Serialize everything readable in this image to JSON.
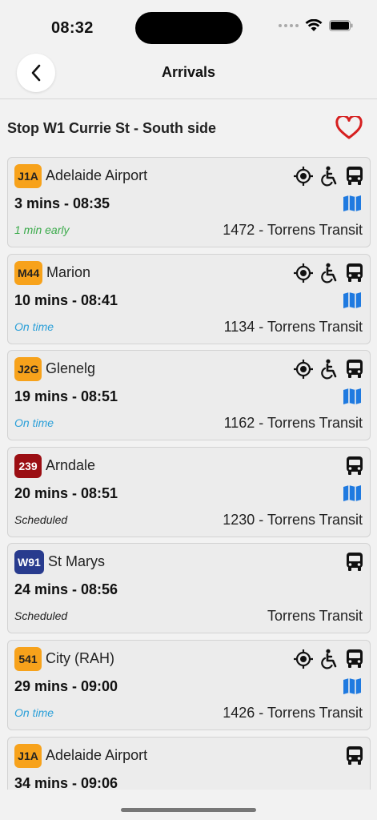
{
  "status_bar": {
    "time": "08:32"
  },
  "header": {
    "title": "Arrivals"
  },
  "stop": {
    "name": "Stop W1 Currie St - South side"
  },
  "colors": {
    "orange": "#f7a21b",
    "red": "#9b0e13",
    "navy": "#283b8e",
    "early_green": "#3aaa4a",
    "ontime_blue": "#2a9fd8",
    "map_blue": "#1f7ae0",
    "favorite_red": "#d62020"
  },
  "arrivals": [
    {
      "route": "J1A",
      "badge_color": "#f7a21b",
      "badge_text_color": "#222222",
      "destination": "Adelaide Airport",
      "eta": "3 mins - 08:35",
      "status": "1 min early",
      "status_color": "#3aaa4a",
      "operator": "1472 - Torrens Transit",
      "gps": true,
      "accessible": true,
      "map": true
    },
    {
      "route": "M44",
      "badge_color": "#f7a21b",
      "badge_text_color": "#222222",
      "destination": "Marion",
      "eta": "10 mins - 08:41",
      "status": "On time",
      "status_color": "#2a9fd8",
      "operator": "1134 - Torrens Transit",
      "gps": true,
      "accessible": true,
      "map": true
    },
    {
      "route": "J2G",
      "badge_color": "#f7a21b",
      "badge_text_color": "#222222",
      "destination": "Glenelg",
      "eta": "19 mins - 08:51",
      "status": "On time",
      "status_color": "#2a9fd8",
      "operator": "1162 - Torrens Transit",
      "gps": true,
      "accessible": true,
      "map": true
    },
    {
      "route": "239",
      "badge_color": "#9b0e13",
      "badge_text_color": "#ffffff",
      "destination": "Arndale",
      "eta": "20 mins - 08:51",
      "status": "Scheduled",
      "status_color": "#222222",
      "operator": "1230 - Torrens Transit",
      "gps": false,
      "accessible": false,
      "map": true
    },
    {
      "route": "W91",
      "badge_color": "#283b8e",
      "badge_text_color": "#ffffff",
      "destination": "St Marys",
      "eta": "24 mins - 08:56",
      "status": "Scheduled",
      "status_color": "#222222",
      "operator": "Torrens Transit",
      "gps": false,
      "accessible": false,
      "map": false
    },
    {
      "route": "541",
      "badge_color": "#f7a21b",
      "badge_text_color": "#222222",
      "destination": "City (RAH)",
      "eta": "29 mins - 09:00",
      "status": "On time",
      "status_color": "#2a9fd8",
      "operator": "1426 - Torrens Transit",
      "gps": true,
      "accessible": true,
      "map": true
    },
    {
      "route": "J1A",
      "badge_color": "#f7a21b",
      "badge_text_color": "#222222",
      "destination": "Adelaide Airport",
      "eta": "34 mins - 09:06",
      "status": "",
      "status_color": "#222222",
      "operator": "",
      "gps": false,
      "accessible": false,
      "map": false
    }
  ]
}
